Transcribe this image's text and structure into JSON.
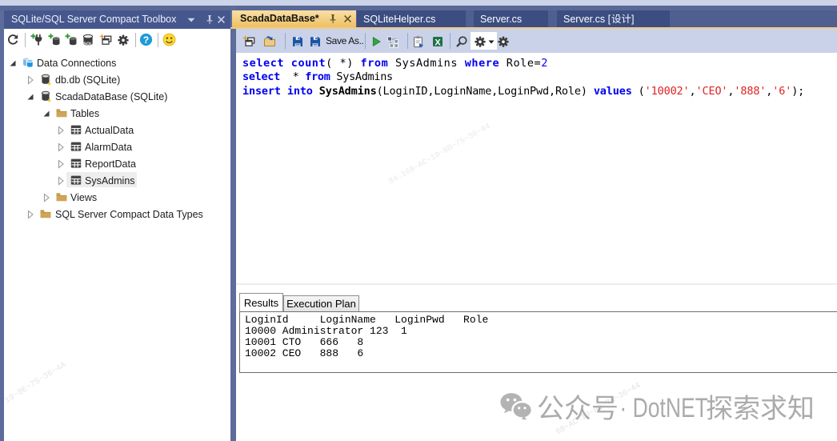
{
  "left_panel": {
    "title": "SQLite/SQL Server Compact Toolbox",
    "title_controls": [
      "window-position",
      "auto-hide-pin",
      "close"
    ],
    "toolbar_icons": [
      "refresh",
      "add-connection",
      "add-sqlite-database",
      "add-sqlce-database",
      "sql-database-script",
      "new-query-window",
      "settings-gear",
      "help",
      "feedback-smiley"
    ],
    "tree": [
      {
        "label": "Data Connections",
        "level": 0,
        "icon": "data-connections",
        "state": "expanded"
      },
      {
        "label": "db.db (SQLite)",
        "level": 1,
        "icon": "database",
        "state": "collapsed"
      },
      {
        "label": "ScadaDataBase (SQLite)",
        "level": 1,
        "icon": "database",
        "state": "expanded"
      },
      {
        "label": "Tables",
        "level": 2,
        "icon": "folder",
        "state": "expanded"
      },
      {
        "label": "ActualData",
        "level": 3,
        "icon": "table",
        "state": "collapsed"
      },
      {
        "label": "AlarmData",
        "level": 3,
        "icon": "table",
        "state": "collapsed"
      },
      {
        "label": "ReportData",
        "level": 3,
        "icon": "table",
        "state": "collapsed"
      },
      {
        "label": "SysAdmins",
        "level": 3,
        "icon": "table",
        "state": "collapsed",
        "selected": true
      },
      {
        "label": "Views",
        "level": 2,
        "icon": "folder",
        "state": "collapsed"
      },
      {
        "label": "SQL Server Compact Data Types",
        "level": 1,
        "icon": "folder",
        "state": "collapsed"
      }
    ]
  },
  "document_tabs": [
    {
      "label": "ScadaDataBase*",
      "active": true,
      "modified": true,
      "controls": [
        "pin",
        "close"
      ]
    },
    {
      "label": "SQLiteHelper.cs",
      "active": false
    },
    {
      "label": "Server.cs",
      "active": false
    },
    {
      "label": "Server.cs [设计]",
      "active": false,
      "label_parts": [
        "Server.cs [",
        "设计",
        "]"
      ]
    }
  ],
  "editor_toolbar": {
    "icons": [
      "new-query",
      "open-file",
      "save",
      "save-as",
      "execute",
      "execution-plan",
      "script",
      "export-excel",
      "search",
      "options-gear",
      "options-dropdown",
      "settings-gear"
    ],
    "save_as_label": "Save As.."
  },
  "code": {
    "lines": [
      {
        "tokens": [
          {
            "t": "select",
            "c": "kw"
          },
          {
            "t": " ",
            "c": "pl"
          },
          {
            "t": "count",
            "c": "kw"
          },
          {
            "t": "( *) ",
            "c": "pl"
          },
          {
            "t": "from",
            "c": "kw"
          },
          {
            "t": " SysAdmins ",
            "c": "pl"
          },
          {
            "t": "where",
            "c": "kw"
          },
          {
            "t": " Role=",
            "c": "pl"
          },
          {
            "t": "2",
            "c": "num"
          }
        ]
      },
      {
        "tokens": [
          {
            "t": "select",
            "c": "kw"
          },
          {
            "t": "  * ",
            "c": "pl"
          },
          {
            "t": "from",
            "c": "kw"
          },
          {
            "t": " SysAdmins",
            "c": "pl"
          }
        ]
      },
      {
        "tokens": [
          {
            "t": "insert",
            "c": "kw"
          },
          {
            "t": " ",
            "c": "pl"
          },
          {
            "t": "into",
            "c": "kw"
          },
          {
            "t": " ",
            "c": "pl"
          },
          {
            "t": "SysAdmins",
            "c": "idb"
          },
          {
            "t": "(LoginID,LoginName,LoginPwd,Role) ",
            "c": "pl"
          },
          {
            "t": "values",
            "c": "kw"
          },
          {
            "t": " (",
            "c": "pl"
          },
          {
            "t": "'10002'",
            "c": "str"
          },
          {
            "t": ",",
            "c": "pl"
          },
          {
            "t": "'CEO'",
            "c": "str"
          },
          {
            "t": ",",
            "c": "pl"
          },
          {
            "t": "'888'",
            "c": "str"
          },
          {
            "t": ",",
            "c": "pl"
          },
          {
            "t": "'6'",
            "c": "str"
          },
          {
            "t": ");",
            "c": "pl"
          }
        ]
      }
    ]
  },
  "results": {
    "tabs": [
      {
        "label": "Results",
        "active": true
      },
      {
        "label": "Execution Plan",
        "active": false
      }
    ],
    "lines": [
      "LoginId     LoginName   LoginPwd   Role",
      "10000 Administrator 123  1",
      "10001 CTO   666   8",
      "10002 CEO   888   6"
    ],
    "columns": [
      "LoginId",
      "LoginName",
      "LoginPwd",
      "Role"
    ],
    "rows": [
      [
        "10000",
        "Administrator",
        "123",
        "1"
      ],
      [
        "10001",
        "CTO",
        "666",
        "8"
      ],
      [
        "10002",
        "CEO",
        "888",
        "6"
      ]
    ]
  },
  "watermarks": {
    "diagonal_1": "84.168~AC~19~8B~75~36~44",
    "diagonal_2": "19~8E~75~36~4A",
    "diagonal_3": "68~AC~19~8B~76~36~44",
    "wechat_text": "公众号 · DotNET探索求知",
    "wechat_parts": [
      "公众号",
      " · DotNET",
      "探索求知"
    ]
  },
  "colors": {
    "active_tab_orange": "#f3cb82",
    "tab_underline": "#f1ca84",
    "inactive_tab_blue": "#3b4d81",
    "panel_title_blue": "#45578d",
    "frame_blue": "#5e6c9c",
    "toolbar_periwinkle": "#c9d2e9",
    "keyword_blue": "#0000f0",
    "string_red": "#dd2222",
    "help_blue": "#1e9bd7",
    "smiley_yellow": "#fdd82e",
    "excel_green": "#1f7145",
    "save_blue": "#1d55a5",
    "folder_tan": "#cfa558",
    "db_blue": "#2b8fdf",
    "watermark_gray": "#ababab"
  }
}
